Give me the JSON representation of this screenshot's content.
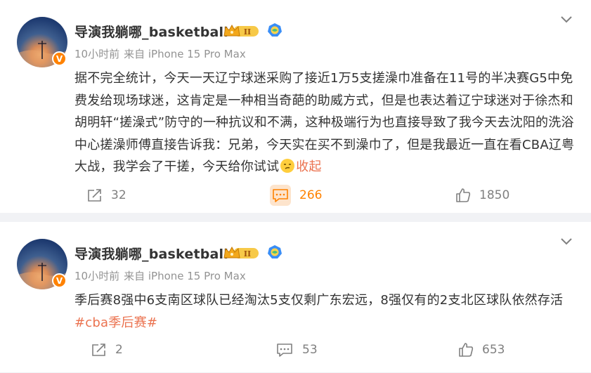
{
  "posts": [
    {
      "author": "导演我躺哪_basketball",
      "crown_badge": "II",
      "verified_badge": "V",
      "time": "10小时前",
      "source": "来自 iPhone 15 Pro Max",
      "text": "据不完全统计，今天一天辽宁球迷采购了接近1万5支搓澡巾准备在11号的半决赛G5中免费发给现场球迷，这肯定是一种相当奇葩的助威方式，但是也表达着辽宁球迷对于徐杰和胡明轩“搓澡式”防守的一种抗议和不满，这种极端行为也直接导致了我今天去沈阳的洗浴中心搓澡师傅直接告诉我：兄弟，今天实在买不到澡巾了，但是我最近一直在看CBA辽粤大战，我学会了干搓，今天给你试试",
      "collapse_label": "收起",
      "reposts": "32",
      "comments": "266",
      "likes": "1850",
      "comments_active": true
    },
    {
      "author": "导演我躺哪_basketball",
      "crown_badge": "II",
      "verified_badge": "V",
      "time": "10小时前",
      "source": "来自 iPhone 15 Pro Max",
      "text": "季后赛8强中6支南区球队已经淘汰5支仅剩广东宏远，8强仅有的2支北区球队依然存活",
      "hashtag": "#cba季后赛#",
      "reposts": "2",
      "comments": "53",
      "likes": "653",
      "comments_active": false
    }
  ],
  "colors": {
    "accent": "#ff8200",
    "link": "#eb7350",
    "muted": "#939393",
    "page_bg": "#f1f2f5"
  }
}
